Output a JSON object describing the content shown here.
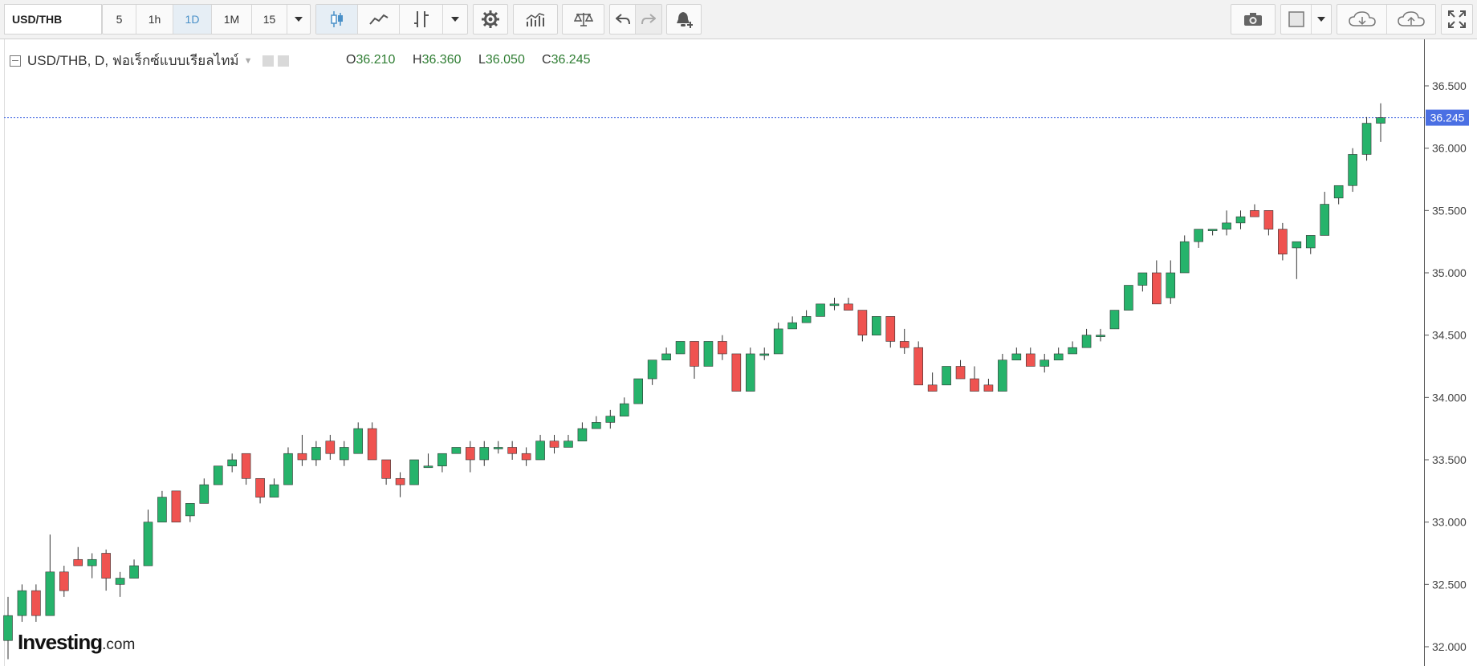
{
  "toolbar": {
    "symbol": "USD/THB",
    "intervals": [
      "5",
      "1h",
      "1D",
      "1M",
      "15"
    ],
    "active_interval": "1D",
    "icons": [
      "candlestick-icon",
      "line-chart-icon",
      "indicators-icon",
      "dropdown-icon",
      "settings-icon",
      "studies-icon",
      "compare-icon",
      "undo-icon",
      "redo-icon",
      "alert-icon",
      "camera-icon",
      "color-icon",
      "cloud-download-icon",
      "cloud-upload-icon",
      "fullscreen-icon"
    ]
  },
  "legend": {
    "title": "USD/THB, D, ฟอเร็กซ์แบบเรียลไทม์",
    "open_label": "O",
    "open": "36.210",
    "high_label": "H",
    "high": "36.360",
    "low_label": "L",
    "low": "36.050",
    "close_label": "C",
    "close": "36.245"
  },
  "logo": {
    "main": "Investing",
    "suffix": ".com"
  },
  "colors": {
    "up": "#26b36b",
    "down": "#ef5350",
    "last_price": "#4a6fe3"
  },
  "chart_data": {
    "type": "candlestick",
    "ylim": [
      31.95,
      36.85
    ],
    "yticks": [
      "36.500",
      "36.000",
      "35.500",
      "35.000",
      "34.500",
      "34.000",
      "33.500",
      "33.000",
      "32.500",
      "32.000"
    ],
    "last_price": "36.245",
    "ohlc": [
      [
        32.05,
        32.4,
        31.9,
        32.25
      ],
      [
        32.25,
        32.5,
        32.2,
        32.45
      ],
      [
        32.45,
        32.5,
        32.2,
        32.25
      ],
      [
        32.25,
        32.9,
        32.25,
        32.6
      ],
      [
        32.6,
        32.65,
        32.4,
        32.45
      ],
      [
        32.7,
        32.8,
        32.65,
        32.65
      ],
      [
        32.65,
        32.75,
        32.55,
        32.7
      ],
      [
        32.75,
        32.78,
        32.45,
        32.55
      ],
      [
        32.5,
        32.6,
        32.4,
        32.55
      ],
      [
        32.55,
        32.7,
        32.55,
        32.65
      ],
      [
        32.65,
        33.1,
        32.65,
        33.0
      ],
      [
        33.0,
        33.25,
        33.0,
        33.2
      ],
      [
        33.25,
        33.25,
        33.0,
        33.0
      ],
      [
        33.05,
        33.15,
        33.0,
        33.15
      ],
      [
        33.15,
        33.35,
        33.15,
        33.3
      ],
      [
        33.3,
        33.45,
        33.3,
        33.45
      ],
      [
        33.45,
        33.55,
        33.4,
        33.5
      ],
      [
        33.55,
        33.55,
        33.3,
        33.35
      ],
      [
        33.35,
        33.35,
        33.15,
        33.2
      ],
      [
        33.2,
        33.35,
        33.2,
        33.3
      ],
      [
        33.3,
        33.6,
        33.3,
        33.55
      ],
      [
        33.55,
        33.7,
        33.45,
        33.5
      ],
      [
        33.5,
        33.65,
        33.45,
        33.6
      ],
      [
        33.65,
        33.7,
        33.5,
        33.55
      ],
      [
        33.5,
        33.65,
        33.45,
        33.6
      ],
      [
        33.55,
        33.8,
        33.55,
        33.75
      ],
      [
        33.75,
        33.8,
        33.5,
        33.5
      ],
      [
        33.5,
        33.5,
        33.3,
        33.35
      ],
      [
        33.35,
        33.4,
        33.2,
        33.3
      ],
      [
        33.3,
        33.5,
        33.3,
        33.5
      ],
      [
        33.45,
        33.55,
        33.45,
        33.45
      ],
      [
        33.45,
        33.55,
        33.4,
        33.55
      ],
      [
        33.55,
        33.6,
        33.55,
        33.6
      ],
      [
        33.6,
        33.65,
        33.4,
        33.5
      ],
      [
        33.5,
        33.65,
        33.45,
        33.6
      ],
      [
        33.6,
        33.65,
        33.55,
        33.6
      ],
      [
        33.6,
        33.65,
        33.5,
        33.55
      ],
      [
        33.55,
        33.6,
        33.45,
        33.5
      ],
      [
        33.5,
        33.7,
        33.5,
        33.65
      ],
      [
        33.65,
        33.7,
        33.55,
        33.6
      ],
      [
        33.6,
        33.7,
        33.6,
        33.65
      ],
      [
        33.65,
        33.8,
        33.65,
        33.75
      ],
      [
        33.75,
        33.85,
        33.75,
        33.8
      ],
      [
        33.8,
        33.9,
        33.75,
        33.85
      ],
      [
        33.85,
        34.0,
        33.85,
        33.95
      ],
      [
        33.95,
        34.15,
        33.95,
        34.15
      ],
      [
        34.15,
        34.3,
        34.1,
        34.3
      ],
      [
        34.3,
        34.4,
        34.3,
        34.35
      ],
      [
        34.35,
        34.45,
        34.35,
        34.45
      ],
      [
        34.45,
        34.45,
        34.15,
        34.25
      ],
      [
        34.25,
        34.45,
        34.25,
        34.45
      ],
      [
        34.45,
        34.5,
        34.3,
        34.35
      ],
      [
        34.35,
        34.35,
        34.05,
        34.05
      ],
      [
        34.05,
        34.4,
        34.05,
        34.35
      ],
      [
        34.35,
        34.4,
        34.3,
        34.35
      ],
      [
        34.35,
        34.6,
        34.35,
        34.55
      ],
      [
        34.55,
        34.65,
        34.55,
        34.6
      ],
      [
        34.6,
        34.7,
        34.6,
        34.65
      ],
      [
        34.65,
        34.75,
        34.65,
        34.75
      ],
      [
        34.75,
        34.8,
        34.7,
        34.75
      ],
      [
        34.75,
        34.8,
        34.7,
        34.7
      ],
      [
        34.7,
        34.7,
        34.45,
        34.5
      ],
      [
        34.5,
        34.65,
        34.5,
        34.65
      ],
      [
        34.65,
        34.65,
        34.4,
        34.45
      ],
      [
        34.45,
        34.55,
        34.35,
        34.4
      ],
      [
        34.4,
        34.45,
        34.1,
        34.1
      ],
      [
        34.1,
        34.2,
        34.05,
        34.05
      ],
      [
        34.1,
        34.25,
        34.1,
        34.25
      ],
      [
        34.25,
        34.3,
        34.15,
        34.15
      ],
      [
        34.15,
        34.25,
        34.05,
        34.05
      ],
      [
        34.1,
        34.15,
        34.05,
        34.05
      ],
      [
        34.05,
        34.35,
        34.05,
        34.3
      ],
      [
        34.3,
        34.4,
        34.3,
        34.35
      ],
      [
        34.35,
        34.4,
        34.25,
        34.25
      ],
      [
        34.25,
        34.35,
        34.2,
        34.3
      ],
      [
        34.3,
        34.4,
        34.3,
        34.35
      ],
      [
        34.35,
        34.45,
        34.35,
        34.4
      ],
      [
        34.4,
        34.55,
        34.4,
        34.5
      ],
      [
        34.5,
        34.55,
        34.45,
        34.5
      ],
      [
        34.55,
        34.7,
        34.55,
        34.7
      ],
      [
        34.7,
        34.9,
        34.7,
        34.9
      ],
      [
        34.9,
        35.0,
        34.85,
        35.0
      ],
      [
        35.0,
        35.1,
        34.75,
        34.75
      ],
      [
        34.8,
        35.1,
        34.75,
        35.0
      ],
      [
        35.0,
        35.3,
        35.0,
        35.25
      ],
      [
        35.25,
        35.35,
        35.2,
        35.35
      ],
      [
        35.35,
        35.35,
        35.3,
        35.35
      ],
      [
        35.35,
        35.5,
        35.3,
        35.4
      ],
      [
        35.4,
        35.5,
        35.35,
        35.45
      ],
      [
        35.5,
        35.55,
        35.45,
        35.45
      ],
      [
        35.5,
        35.5,
        35.3,
        35.35
      ],
      [
        35.35,
        35.4,
        35.1,
        35.15
      ],
      [
        35.2,
        35.25,
        34.95,
        35.25
      ],
      [
        35.2,
        35.3,
        35.15,
        35.3
      ],
      [
        35.3,
        35.65,
        35.3,
        35.55
      ],
      [
        35.6,
        35.7,
        35.55,
        35.7
      ],
      [
        35.7,
        36.0,
        35.65,
        35.95
      ],
      [
        35.95,
        36.25,
        35.9,
        36.2
      ],
      [
        36.2,
        36.36,
        36.05,
        36.245
      ]
    ]
  }
}
